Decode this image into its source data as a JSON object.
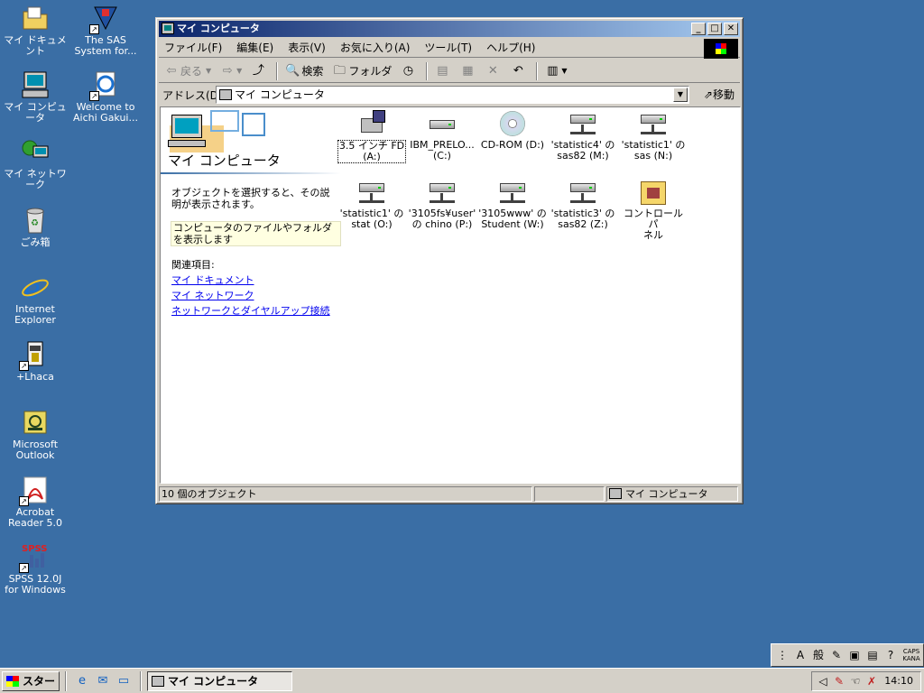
{
  "desktop": {
    "icons": [
      {
        "label": "マイ ドキュメント",
        "icon": "folder-documents-icon"
      },
      {
        "label": "The SAS\nSystem for...",
        "icon": "sas-icon"
      },
      {
        "label": "マイ コンピュータ",
        "icon": "my-computer-icon"
      },
      {
        "label": "Welcome to\nAichi Gakui...",
        "icon": "ie-page-icon"
      },
      {
        "label": "マイ ネットワーク",
        "icon": "network-icon"
      },
      {
        "label": "ごみ箱",
        "icon": "recycle-bin-icon"
      },
      {
        "label": "Internet\nExplorer",
        "icon": "internet-explorer-icon"
      },
      {
        "label": "+Lhaca",
        "icon": "lhaca-icon"
      },
      {
        "label": "Microsoft\nOutlook",
        "icon": "outlook-icon"
      },
      {
        "label": "Acrobat\nReader 5.0",
        "icon": "acrobat-icon"
      },
      {
        "label": "SPSS 12.0J\nfor Windows",
        "icon": "spss-icon"
      }
    ]
  },
  "window": {
    "title": "マイ コンピュータ",
    "menu": [
      "ファイル(F)",
      "編集(E)",
      "表示(V)",
      "お気に入り(A)",
      "ツール(T)",
      "ヘルプ(H)"
    ],
    "toolbar": {
      "back": "戻る",
      "search": "検索",
      "folders": "フォルダ"
    },
    "address": {
      "label": "アドレス(D)",
      "value": "マイ コンピュータ",
      "go": "移動"
    },
    "panel": {
      "title": "マイ コンピュータ",
      "description": "オブジェクトを選択すると、その説明が表示されます。",
      "tip": "コンピュータのファイルやフォルダを表示します",
      "related_heading": "関連項目:",
      "links": [
        "マイ ドキュメント",
        "マイ ネットワーク",
        "ネットワークとダイヤルアップ接続"
      ]
    },
    "items": [
      {
        "label": "3.5 インチ FD\n(A:)",
        "icon": "floppy-drive-icon"
      },
      {
        "label": "IBM_PRELO...\n(C:)",
        "icon": "hard-drive-icon"
      },
      {
        "label": "CD-ROM (D:)",
        "icon": "cd-rom-icon"
      },
      {
        "label": "'statistic4' の\nsas82 (M:)",
        "icon": "network-drive-icon"
      },
      {
        "label": "'statistic1' の\nsas (N:)",
        "icon": "network-drive-icon"
      },
      {
        "label": "'statistic1' の\nstat (O:)",
        "icon": "network-drive-icon"
      },
      {
        "label": "'3105fs¥user'\nの chino (P:)",
        "icon": "network-drive-icon"
      },
      {
        "label": "'3105www' の\nStudent (W:)",
        "icon": "network-drive-icon"
      },
      {
        "label": "'statistic3' の\nsas82 (Z:)",
        "icon": "network-drive-icon"
      },
      {
        "label": "コントロール パ\nネル",
        "icon": "control-panel-icon"
      }
    ],
    "status": {
      "count": "10 個のオブジェクト",
      "zone": "マイ コンピュータ"
    }
  },
  "langbar": {
    "mode1": "A",
    "mode2": "般",
    "caps": "CAPS\nKANA"
  },
  "taskbar": {
    "start": "スタート",
    "task": "マイ コンピュータ",
    "clock": "14:10"
  }
}
